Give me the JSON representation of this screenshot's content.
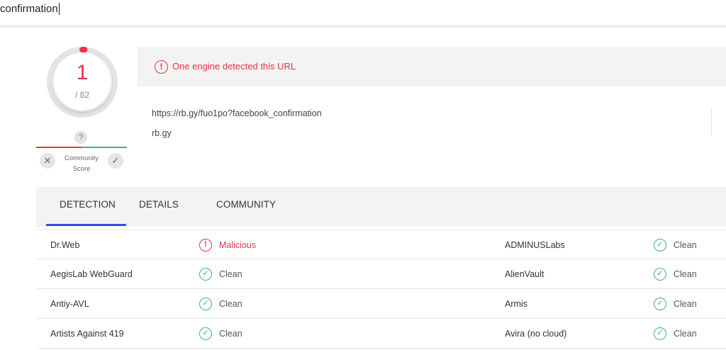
{
  "search": {
    "value": "confirmation"
  },
  "score": {
    "detections": "1",
    "total": "/ 82",
    "detection_fraction": 0.0122,
    "ring_color": "#e8334a",
    "unknown_badge": "?",
    "community_label_line1": "Community",
    "community_label_line2": "Score",
    "vote_down_glyph": "✕",
    "vote_up_glyph": "✓"
  },
  "alert": {
    "icon": "exclamation-circle-icon",
    "text": "One engine detected this URL",
    "color": "#e8334a"
  },
  "url_info": {
    "url": "https://rb.gy/fuo1po?facebook_confirmation",
    "domain": "rb.gy"
  },
  "tabs": [
    {
      "label": "DETECTION",
      "active": true
    },
    {
      "label": "DETAILS",
      "active": false
    },
    {
      "label": "COMMUNITY",
      "active": false
    }
  ],
  "detections": [
    {
      "left": {
        "engine": "Dr.Web",
        "result": "Malicious",
        "status": "malicious"
      },
      "right": {
        "engine": "ADMINUSLabs",
        "result": "Clean",
        "status": "clean"
      }
    },
    {
      "left": {
        "engine": "AegisLab WebGuard",
        "result": "Clean",
        "status": "clean"
      },
      "right": {
        "engine": "AlienVault",
        "result": "Clean",
        "status": "clean"
      }
    },
    {
      "left": {
        "engine": "Antiy-AVL",
        "result": "Clean",
        "status": "clean"
      },
      "right": {
        "engine": "Armis",
        "result": "Clean",
        "status": "clean"
      }
    },
    {
      "left": {
        "engine": "Artists Against 419",
        "result": "Clean",
        "status": "clean"
      },
      "right": {
        "engine": "Avira (no cloud)",
        "result": "Clean",
        "status": "clean"
      }
    }
  ],
  "colors": {
    "malicious": "#e8334a",
    "clean": "#3fb37f",
    "tab_accent": "#3a4ee0"
  }
}
